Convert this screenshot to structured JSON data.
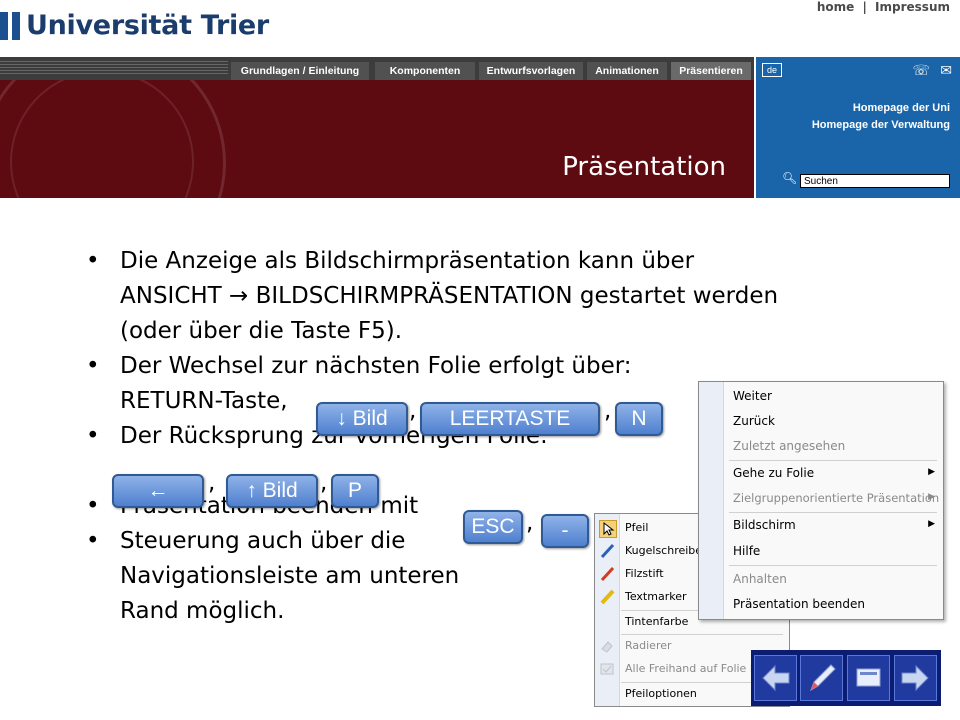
{
  "header": {
    "logo_text": "Universität Trier",
    "top_links": [
      "home",
      "|",
      "Impressum"
    ],
    "nav_tabs": [
      "Grundlagen / Einleitung",
      "Komponenten",
      "Entwurfsvorlagen",
      "Animationen",
      "Präsentieren"
    ],
    "active_tab": "Präsentieren",
    "banner_title": "Präsentation",
    "side_panel": {
      "lang": "de",
      "links": [
        "Homepage der Uni",
        "Homepage der Verwaltung"
      ],
      "search_placeholder": "Suchen"
    }
  },
  "slide": {
    "bullets": [
      {
        "lines": [
          "Die Anzeige als Bildschirmpräsentation kann über",
          "ANSICHT  → BILDSCHIRMPRÄSENTATION gestartet werden",
          "(oder über die Taste F5)."
        ]
      },
      {
        "lines": [
          "Der Wechsel zur nächsten Folie erfolgt über:",
          "RETURN-Taste,"
        ]
      },
      {
        "lines": [
          "Der Rücksprung zur vorherigen Folie:",
          ""
        ]
      },
      {
        "lines": [
          "Präsentation beenden mit"
        ]
      },
      {
        "lines": [
          "Steuerung auch über die",
          "Navigationsleiste am unteren",
          "Rand möglich."
        ]
      }
    ],
    "keys": {
      "down": "↓ Bild",
      "space": "LEERTASTE",
      "n": "N",
      "left": "←",
      "up": "↑ Bild",
      "p": "P",
      "esc": "ESC",
      "minus": "-"
    },
    "separator": ","
  },
  "context_menu": {
    "items": [
      {
        "label": "Weiter",
        "enabled": true,
        "submenu": false
      },
      {
        "label": "Zurück",
        "enabled": true,
        "submenu": false
      },
      {
        "label": "Zuletzt angesehen",
        "enabled": false,
        "submenu": false
      },
      {
        "label": "Gehe zu Folie",
        "enabled": true,
        "submenu": true
      },
      {
        "label": "Zielgruppenorientierte Präsentation",
        "enabled": false,
        "submenu": true
      },
      {
        "label": "Bildschirm",
        "enabled": true,
        "submenu": true
      },
      {
        "label": "Hilfe",
        "enabled": true,
        "submenu": false
      },
      {
        "label": "Anhalten",
        "enabled": false,
        "submenu": false
      },
      {
        "label": "Präsentation beenden",
        "enabled": true,
        "submenu": false
      }
    ]
  },
  "pen_menu": {
    "items": [
      {
        "label": "Pfeil",
        "enabled": true,
        "icon": "cursor-icon"
      },
      {
        "label": "Kugelschreiber",
        "enabled": true,
        "icon": "pen-icon"
      },
      {
        "label": "Filzstift",
        "enabled": true,
        "icon": "felt-pen-icon"
      },
      {
        "label": "Textmarker",
        "enabled": true,
        "icon": "highlighter-icon"
      },
      {
        "label": "Tintenfarbe",
        "enabled": true,
        "icon": ""
      },
      {
        "label": "Radierer",
        "enabled": false,
        "icon": "eraser-icon"
      },
      {
        "label": "Alle Freihand auf Folie lösc",
        "enabled": false,
        "icon": "clear-icon"
      },
      {
        "label": "Pfeiloptionen",
        "enabled": true,
        "icon": ""
      }
    ]
  },
  "navbar": {
    "buttons": [
      "back-arrow-icon",
      "pen-icon",
      "screen-icon",
      "forward-arrow-icon"
    ]
  },
  "colors": {
    "banner": "#5d0a10",
    "side_panel": "#1a65a9",
    "key_blue": "#4f80cf",
    "navbar": "#0b1c73"
  }
}
